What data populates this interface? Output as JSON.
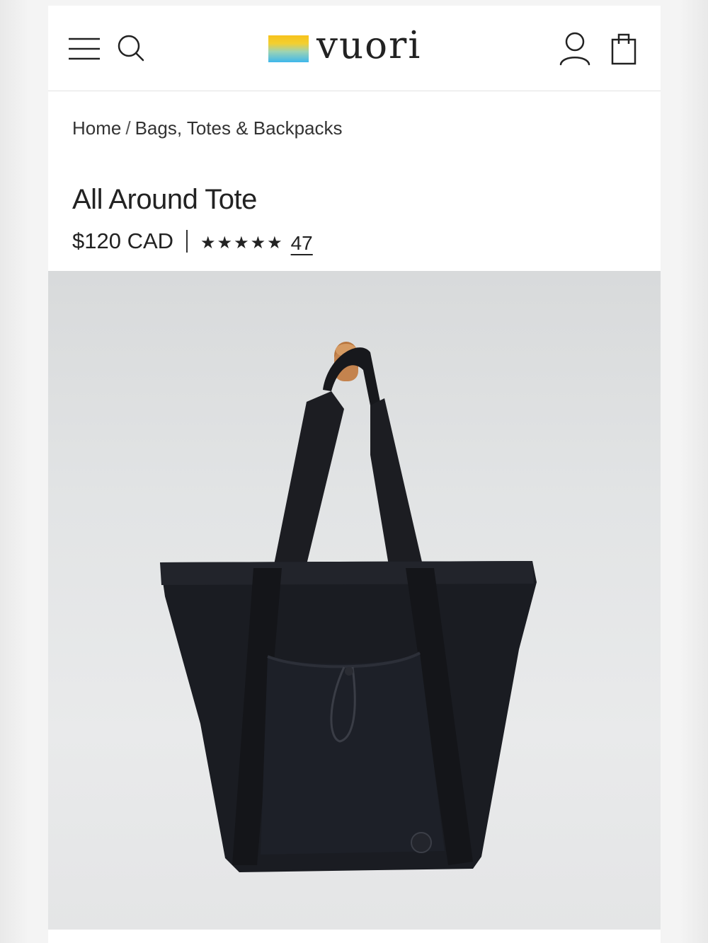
{
  "header": {
    "brand": "vuori",
    "icons": {
      "menu": "hamburger-menu-icon",
      "search": "search-icon",
      "account": "account-icon",
      "cart": "shopping-bag-icon"
    }
  },
  "breadcrumb": {
    "items": [
      "Home",
      "Bags, Totes & Backpacks"
    ],
    "separator": "/"
  },
  "product": {
    "title": "All Around Tote",
    "price": "$120 CAD",
    "rating_stars": "★★★★★",
    "rating_value": 5,
    "review_count": "47",
    "image_alt": "Black quilted tote bag hanging on a wooden wall peg"
  },
  "colors": {
    "text": "#222222",
    "background": "#ffffff",
    "bag": "#1a1c22",
    "peg": "#c4834e"
  }
}
